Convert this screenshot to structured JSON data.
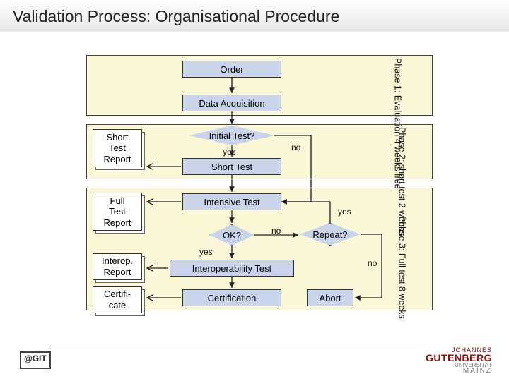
{
  "title": "Validation Process: Organisational Procedure",
  "nodes": {
    "order": "Order",
    "data_acquisition": "Data Acquisition",
    "initial_test": "Initial Test?",
    "short_test": "Short Test",
    "intensive_test": "Intensive Test",
    "ok": "OK?",
    "repeat": "Repeat?",
    "interop_test": "Interoperability Test",
    "certification": "Certification",
    "abort": "Abort"
  },
  "reports": {
    "short": "Short\nTest\nReport",
    "full": "Full\nTest\nReport",
    "interop": "Interop.\nReport",
    "certificate": "Certifi-\ncate"
  },
  "phases": {
    "p1": "Phase 1:\nEvaluation\n4 weeks\nfree",
    "p2": "Phase 2:\nshort test\n2 weeks",
    "p3": "Phase 3:\nFull test\n8 weeks"
  },
  "edge_labels": {
    "yes": "yes",
    "no": "no"
  },
  "footer": {
    "left_brand": "@GIT",
    "left_sub": "····················",
    "right_l1": "JOHANNES",
    "right_l2": "GUTENBERG",
    "right_l3": "UNIVERSITÄT",
    "right_l4": "MAINZ"
  }
}
